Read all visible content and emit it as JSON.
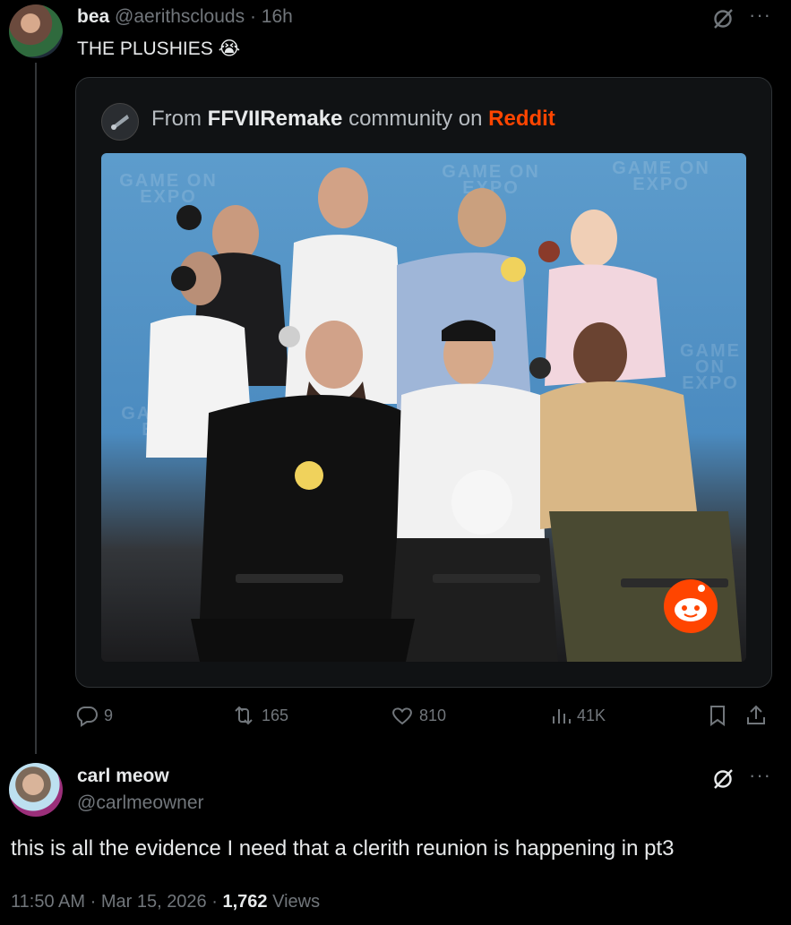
{
  "tweet": {
    "author_name": "bea",
    "author_handle": "@aerithsclouds",
    "time": "· 16h",
    "text": "THE PLUSHIES",
    "emoji": "😭",
    "card": {
      "prefix": "From",
      "community": "FFVIIRemake",
      "middle": "community on",
      "site": "Reddit",
      "photo_watermark": "GAME ON EXPO"
    },
    "stats": {
      "replies": "9",
      "retweets": "165",
      "likes": "810",
      "views": "41K"
    }
  },
  "reply": {
    "author_name": "carl meow",
    "author_handle": "@carlmeowner",
    "text": "this is all the evidence I need that a clerith reunion is happening in pt3",
    "time": "11:50 AM",
    "date": "Mar 15, 2026",
    "views_count": "1,762",
    "views_label": "Views"
  },
  "icons": {
    "grok": "slashed-circle-icon",
    "more": "more-dots-icon",
    "reply": "reply-icon",
    "retweet": "retweet-icon",
    "like": "heart-icon",
    "views": "bar-chart-icon",
    "bookmark": "bookmark-icon",
    "share": "share-icon"
  },
  "colors": {
    "background": "#000000",
    "text": "#e7e9ea",
    "muted": "#71767b",
    "reddit": "#ff4500"
  }
}
